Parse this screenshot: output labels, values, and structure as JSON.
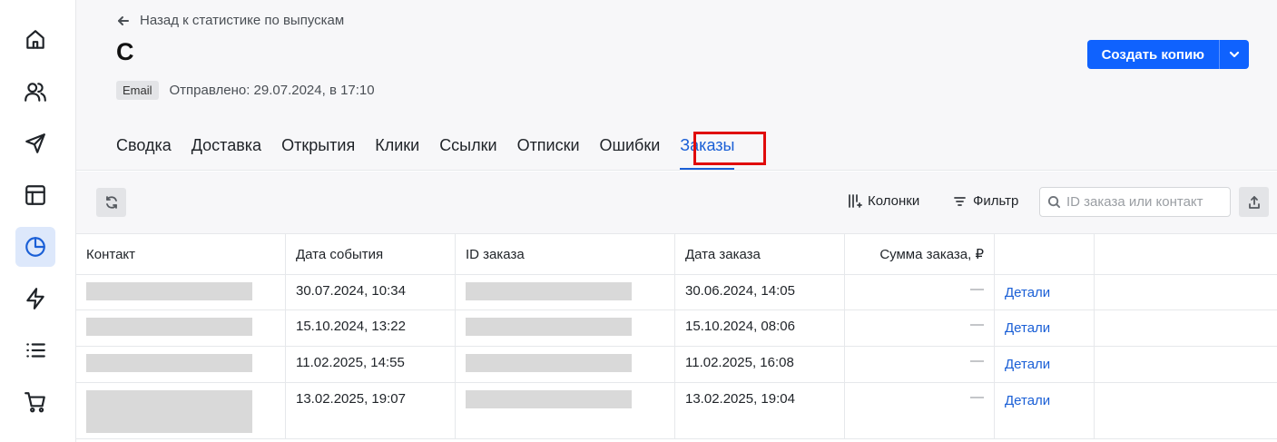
{
  "sidebar": {
    "items": [
      {
        "icon": "home-icon"
      },
      {
        "icon": "users-icon"
      },
      {
        "icon": "send-icon"
      },
      {
        "icon": "layout-icon"
      },
      {
        "icon": "pie-chart-icon",
        "active": true
      },
      {
        "icon": "lightning-icon"
      },
      {
        "icon": "list-icon"
      },
      {
        "icon": "cart-icon"
      }
    ]
  },
  "header": {
    "back_label": "Назад к статистике по выпускам",
    "title": "С",
    "channel_badge": "Email",
    "sent_text": "Отправлено: 29.07.2024, в 17:10",
    "copy_button": "Создать копию"
  },
  "tabs": [
    {
      "label": "Сводка"
    },
    {
      "label": "Доставка"
    },
    {
      "label": "Открытия"
    },
    {
      "label": "Клики"
    },
    {
      "label": "Ссылки"
    },
    {
      "label": "Отписки"
    },
    {
      "label": "Ошибки"
    },
    {
      "label": "Заказы",
      "active": true
    }
  ],
  "toolbar": {
    "columns_label": "Колонки",
    "filter_label": "Фильтр",
    "search_placeholder": "ID заказа или контакт"
  },
  "table": {
    "headers": {
      "contact": "Контакт",
      "event_date": "Дата события",
      "order_id": "ID заказа",
      "order_date": "Дата заказа",
      "order_sum": "Сумма заказа, ₽"
    },
    "rows": [
      {
        "event_date": "30.07.2024, 10:34",
        "order_date": "30.06.2024, 14:05",
        "sum": "—",
        "details": "Детали"
      },
      {
        "event_date": "15.10.2024, 13:22",
        "order_date": "15.10.2024, 08:06",
        "sum": "—",
        "details": "Детали"
      },
      {
        "event_date": "11.02.2025, 14:55",
        "order_date": "11.02.2025, 16:08",
        "sum": "—",
        "details": "Детали"
      },
      {
        "event_date": "13.02.2025, 19:07",
        "order_date": "13.02.2025, 19:04",
        "sum": "—",
        "details": "Детали"
      }
    ]
  },
  "colors": {
    "accent": "#0f62fe",
    "link": "#1a5fd6",
    "highlight": "#e00b0b"
  }
}
